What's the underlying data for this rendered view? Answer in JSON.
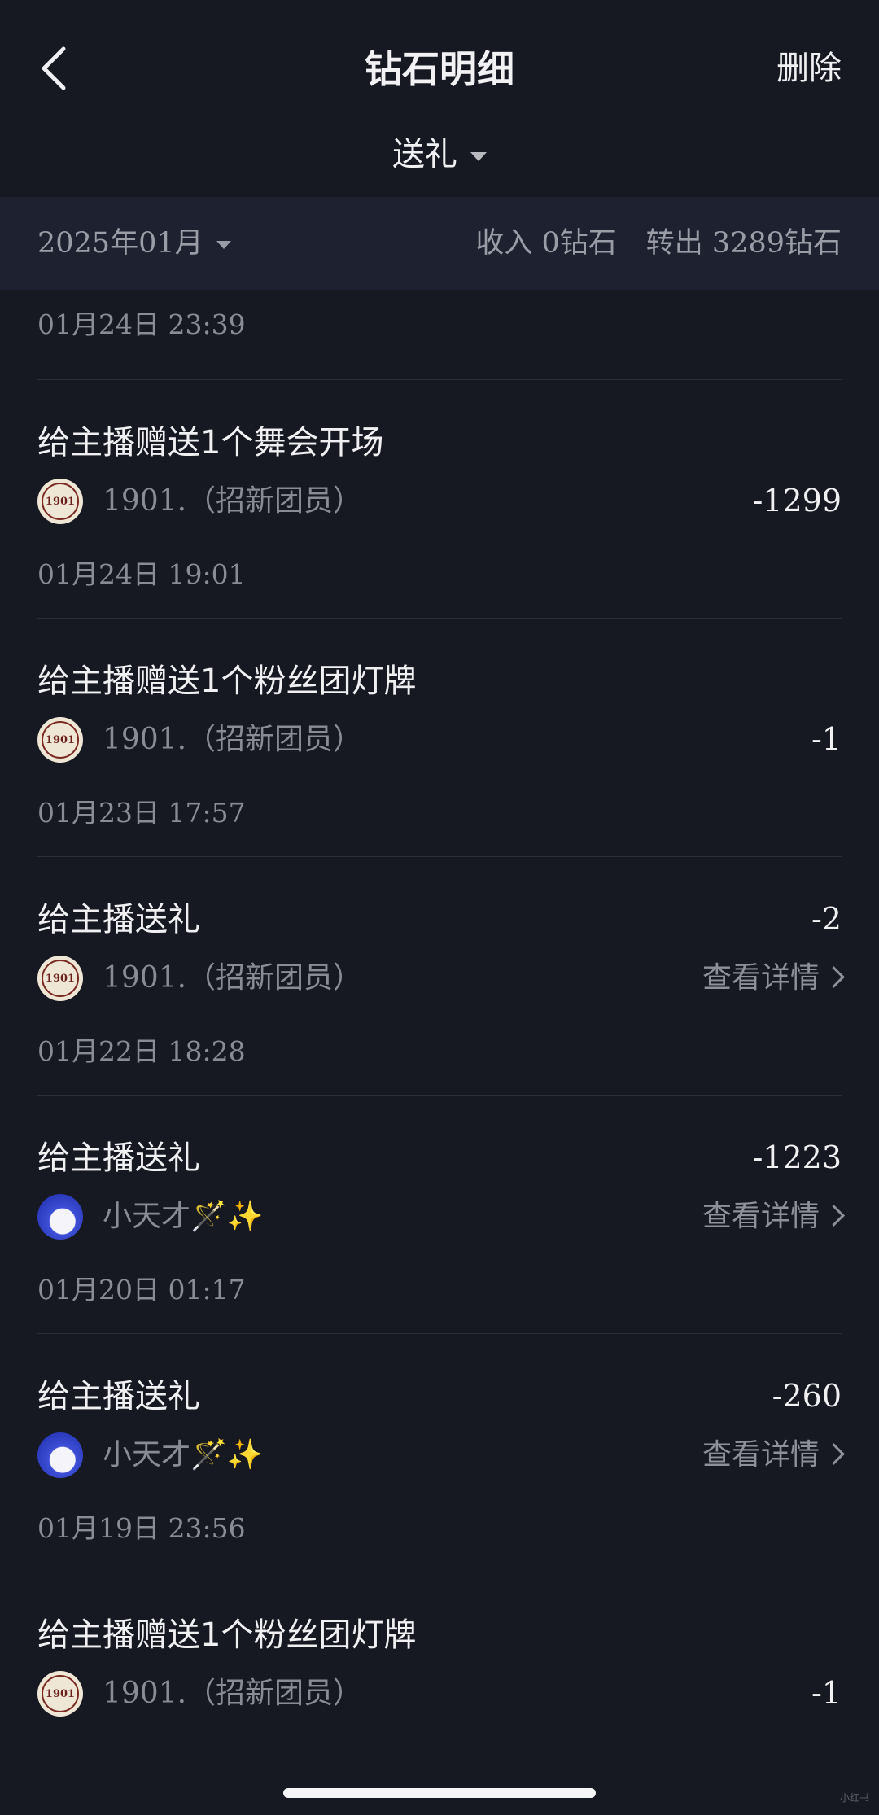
{
  "header": {
    "title": "钻石明细",
    "delete_label": "删除",
    "filter_label": "送礼"
  },
  "summary": {
    "month": "2025年01月",
    "income": "收入 0钻石",
    "outgoing": "转出 3289钻石"
  },
  "first_date": "01月24日 23:39",
  "detail_label": "查看详情",
  "items": [
    {
      "title": "给主播赠送1个舞会开场",
      "user": "1901.（招新团员）",
      "amount": "-1299",
      "date": "01月24日 19:01",
      "avatar": "seal-avatar"
    },
    {
      "title": "给主播赠送1个粉丝团灯牌",
      "user": "1901.（招新团员）",
      "amount": "-1",
      "date": "01月23日 17:57",
      "avatar": "seal-avatar"
    },
    {
      "title": "给主播送礼",
      "user": "1901.（招新团员）",
      "amount": "-2",
      "date": "01月22日 18:28",
      "avatar": "seal-avatar"
    },
    {
      "title": "给主播送礼",
      "user": "小天才🪄✨",
      "amount": "-1223",
      "date": "01月20日 01:17",
      "avatar": "blue-avatar"
    },
    {
      "title": "给主播送礼",
      "user": "小天才🪄✨",
      "amount": "-260",
      "date": "01月19日 23:56",
      "avatar": "blue-avatar"
    },
    {
      "title": "给主播赠送1个粉丝团灯牌",
      "user": "1901.（招新团员）",
      "amount": "-1",
      "date": "",
      "avatar": "seal-avatar"
    }
  ],
  "seal_text": "1901",
  "watermark": "小红书"
}
